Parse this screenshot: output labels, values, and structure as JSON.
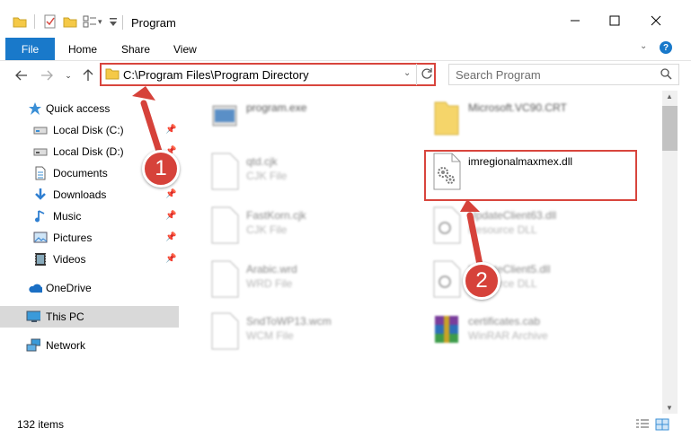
{
  "window": {
    "title": "Program",
    "controls": [
      "minimize",
      "maximize",
      "close"
    ]
  },
  "ribbon": {
    "tabs": [
      {
        "label": "File",
        "active": true
      },
      {
        "label": "Home"
      },
      {
        "label": "Share"
      },
      {
        "label": "View"
      }
    ],
    "help_icon": "help-icon"
  },
  "nav": {
    "address": "C:\\Program Files\\Program Directory",
    "search_placeholder": "Search Program"
  },
  "sidebar": {
    "items": [
      {
        "label": "Quick access",
        "icon": "star-icon"
      },
      {
        "label": "Local Disk (C:)",
        "icon": "drive-icon",
        "pinned": true
      },
      {
        "label": "Local Disk (D:)",
        "icon": "drive-icon",
        "pinned": true
      },
      {
        "label": "Documents",
        "icon": "documents-icon",
        "pinned": true
      },
      {
        "label": "Downloads",
        "icon": "download-icon",
        "pinned": true
      },
      {
        "label": "Music",
        "icon": "music-icon",
        "pinned": true
      },
      {
        "label": "Pictures",
        "icon": "pictures-icon",
        "pinned": true
      },
      {
        "label": "Videos",
        "icon": "videos-icon",
        "pinned": true
      },
      {
        "label": "OneDrive",
        "icon": "cloud-icon"
      },
      {
        "label": "This PC",
        "icon": "computer-icon",
        "selected": true
      },
      {
        "label": "Network",
        "icon": "network-icon"
      }
    ]
  },
  "files": [
    {
      "name": "program.exe",
      "type": ""
    },
    {
      "name": "Microsoft.VC90.CRT",
      "type": ""
    },
    {
      "name": "qtd.cjk",
      "type": "CJK File"
    },
    {
      "name": "imregionalmaxmex.dll",
      "type": ""
    },
    {
      "name": "FastKorn.cjk",
      "type": "CJK File"
    },
    {
      "name": "UpdateClient63.dll",
      "type": "Resource DLL"
    },
    {
      "name": "Arabic.wrd",
      "type": "WRD File"
    },
    {
      "name": "UpdateClient5.dll",
      "type": "Resource DLL"
    },
    {
      "name": "SndToWP13.wcm",
      "type": "WCM File"
    },
    {
      "name": "certificates.cab",
      "type": "WinRAR Archive"
    }
  ],
  "status": {
    "count": "132 items"
  },
  "annotations": {
    "step1": "1",
    "step2": "2"
  },
  "colors": {
    "accent": "#1979ca",
    "highlight": "#d8453d"
  }
}
